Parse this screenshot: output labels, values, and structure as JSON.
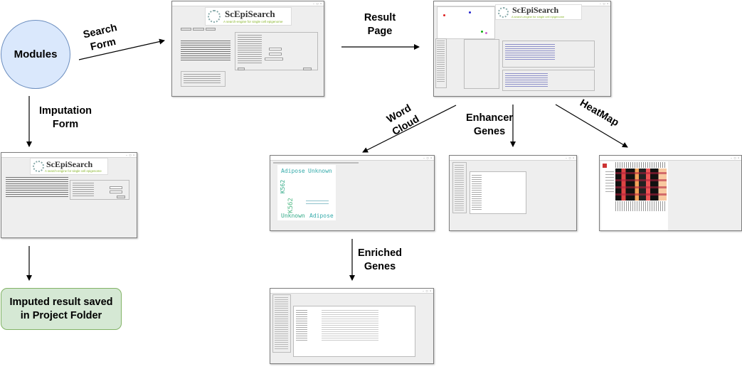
{
  "nodes": {
    "modules": "Modules",
    "imputed_result": "Imputed result saved in Project Folder"
  },
  "edges": {
    "search_form": "Search Form",
    "imputation_form": "Imputation Form",
    "result_page": "Result Page",
    "word_cloud": "Word Cloud",
    "enhancer_genes": "Enhancer Genes",
    "heatmap": "HeatMap",
    "enriched_genes": "Enriched Genes"
  },
  "app": {
    "logo_title": "ScEpiSearch",
    "logo_subtitle": "A search-engine for single cell epigenome"
  },
  "word_cloud_words": [
    "Adipose",
    "Unknown",
    "K562",
    "K562",
    "Unknown",
    "Adipose"
  ],
  "colors": {
    "modules_fill": "#dae8fc",
    "modules_stroke": "#6c8ebf",
    "result_fill": "#d5e8d4",
    "result_stroke": "#82b366"
  }
}
